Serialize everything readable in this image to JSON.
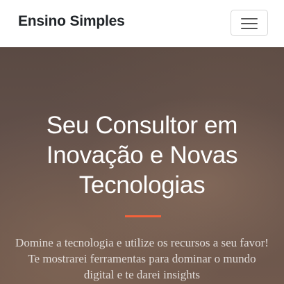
{
  "navbar": {
    "brand": "Ensino Simples",
    "toggler_icon": "hamburger-menu-icon"
  },
  "hero": {
    "title": "Seu Consultor em Inovação e Novas Tecnologias",
    "divider_color": "#f4623a",
    "text": "Domine a tecnologia e utilize os recursos a seu favor! Te mostrarei ferramentas para dominar o mundo digital e te darei insights"
  },
  "colors": {
    "navbar_bg": "#ffffff",
    "brand_text": "#212529",
    "accent": "#f4623a",
    "hero_overlay": "#5b4b44"
  }
}
